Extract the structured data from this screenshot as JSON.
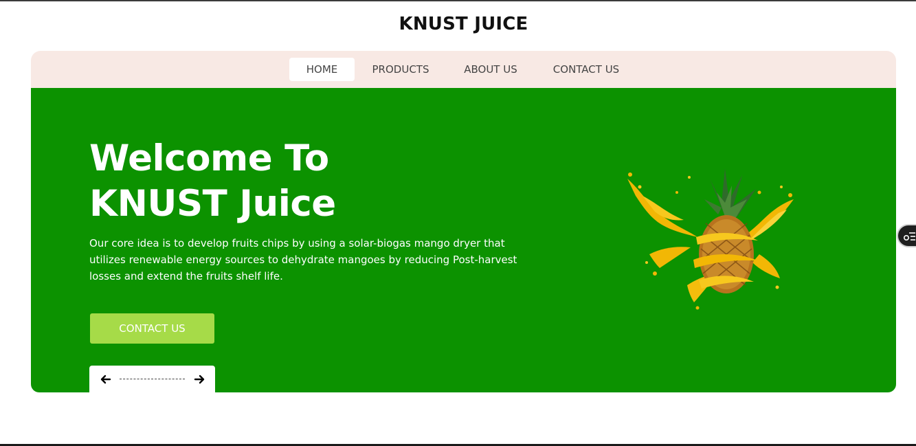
{
  "site": {
    "title": "KNUST JUICE"
  },
  "nav": {
    "items": [
      {
        "label": "HOME",
        "active": true
      },
      {
        "label": "PRODUCTS",
        "active": false
      },
      {
        "label": "ABOUT US",
        "active": false
      },
      {
        "label": "CONTACT US",
        "active": false
      }
    ]
  },
  "hero": {
    "title_line1": "Welcome To",
    "title_line2": "KNUST Juice",
    "description": "Our core idea is to develop fruits chips by using a solar-biogas mango dryer that utilizes renewable energy sources to dehydrate mangoes by reducing Post-harvest losses and extend the fruits shelf life.",
    "cta_label": "CONTACT US",
    "image": "pineapple-juice-splash"
  },
  "slider": {
    "prev_icon": "arrow-left-icon",
    "next_icon": "arrow-right-icon"
  },
  "side_widget": {
    "icon": "accessibility-menu-icon"
  },
  "colors": {
    "hero_bg": "#0c9200",
    "nav_bg": "#f8e9e4",
    "cta_bg": "#a6db48",
    "title": "#111111"
  }
}
